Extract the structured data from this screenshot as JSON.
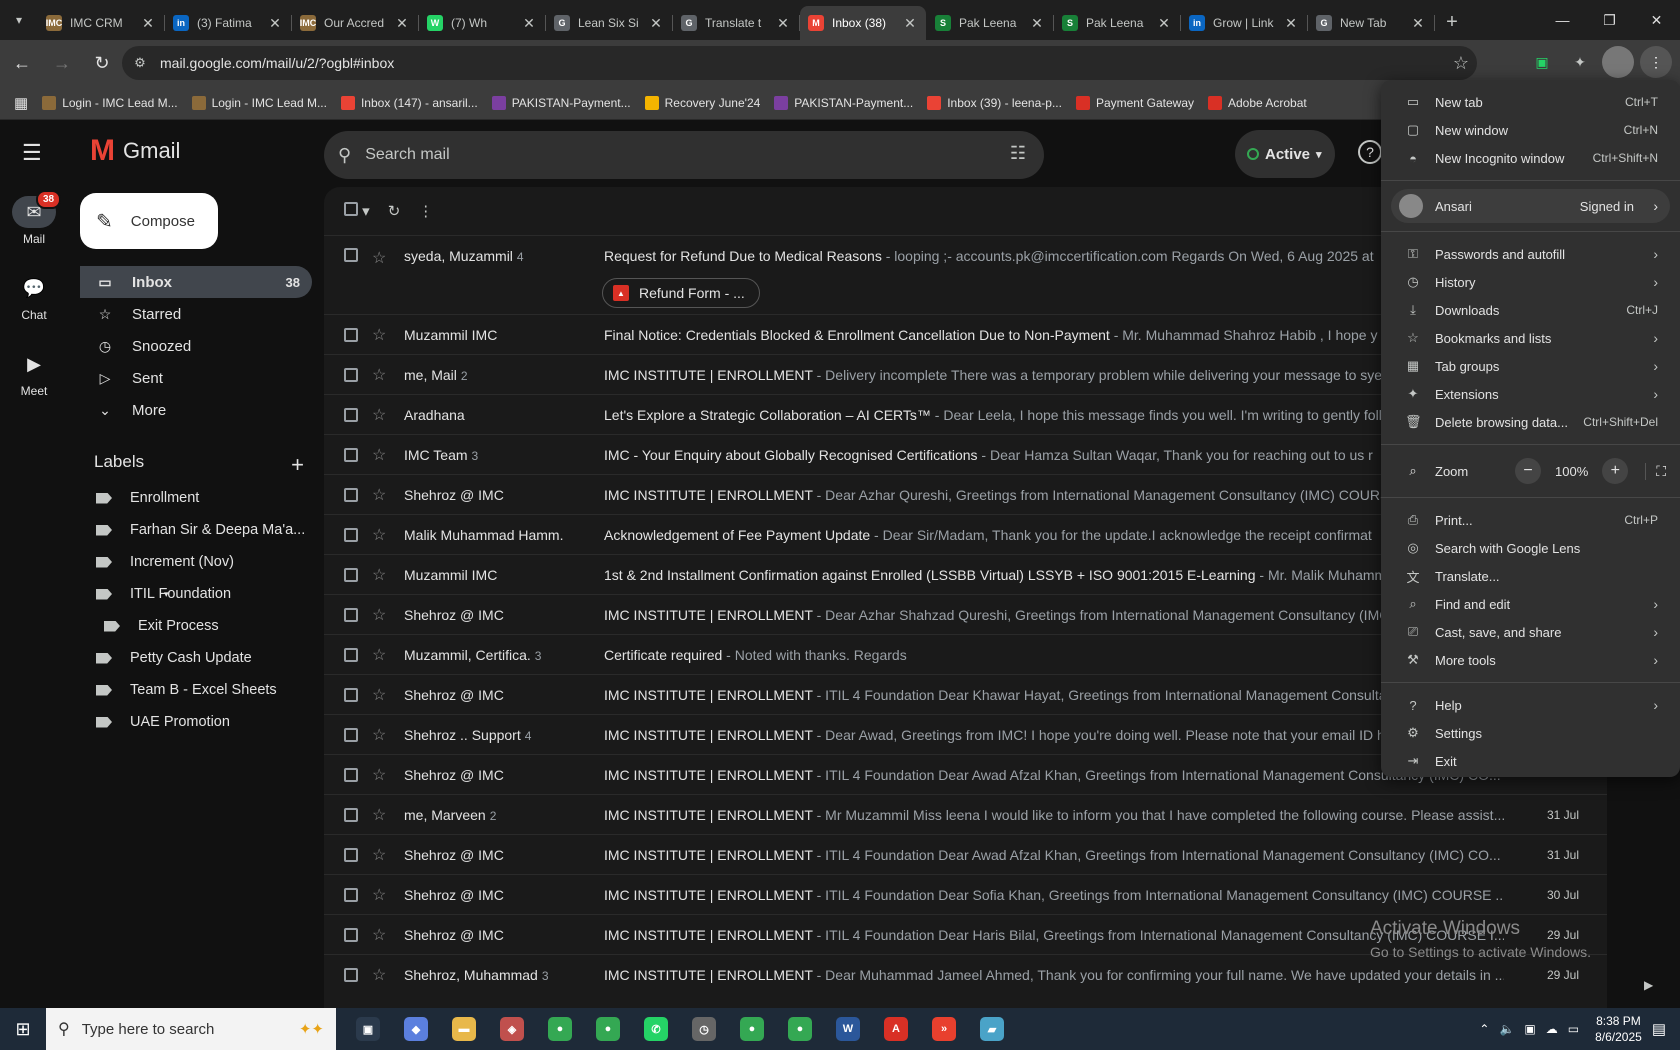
{
  "tabs": [
    {
      "title": "IMC CRM",
      "favicon": "IMC",
      "color": "#8b6a3a",
      "active": false
    },
    {
      "title": "(3) Fatima",
      "favicon": "in",
      "color": "#0a66c2",
      "active": false
    },
    {
      "title": "Our Accred",
      "favicon": "IMC",
      "color": "#8b6a3a",
      "active": false
    },
    {
      "title": "(7) Wh",
      "favicon": "W",
      "color": "#25d366",
      "active": false
    },
    {
      "title": "Lean Six Si",
      "favicon": "G",
      "color": "#5f6368",
      "active": false
    },
    {
      "title": "Translate t",
      "favicon": "G",
      "color": "#5f6368",
      "active": false
    },
    {
      "title": "Inbox (38)",
      "favicon": "M",
      "color": "#ea4335",
      "active": true
    },
    {
      "title": "Pak Leena",
      "favicon": "S",
      "color": "#188038",
      "active": false
    },
    {
      "title": "Pak Leena",
      "favicon": "S",
      "color": "#188038",
      "active": false
    },
    {
      "title": "Grow | Link",
      "favicon": "in",
      "color": "#0a66c2",
      "active": false
    },
    {
      "title": "New Tab",
      "favicon": "G",
      "color": "#5f6368",
      "active": false
    }
  ],
  "address": {
    "url": "mail.google.com/mail/u/2/?ogbl#inbox"
  },
  "bookmarks": [
    {
      "label": "Login - IMC Lead M...",
      "color": "#8b6a3a"
    },
    {
      "label": "Login - IMC Lead M...",
      "color": "#8b6a3a"
    },
    {
      "label": "Inbox (147) - ansaril...",
      "color": "#ea4335"
    },
    {
      "label": "PAKISTAN-Payment...",
      "color": "#7b3fa0"
    },
    {
      "label": "Recovery June'24",
      "color": "#f4b400"
    },
    {
      "label": "PAKISTAN-Payment...",
      "color": "#7b3fa0"
    },
    {
      "label": "Inbox (39) - leena-p...",
      "color": "#ea4335"
    },
    {
      "label": "Payment Gateway",
      "color": "#d93025"
    },
    {
      "label": "Adobe Acrobat",
      "color": "#d93025"
    }
  ],
  "gmail": {
    "brand": "Gmail",
    "compose": "Compose",
    "search_placeholder": "Search mail",
    "status": "Active",
    "rail": [
      {
        "label": "Mail",
        "badge": "38"
      },
      {
        "label": "Chat"
      },
      {
        "label": "Meet"
      }
    ],
    "folders": [
      {
        "label": "Inbox",
        "count": "38",
        "icon": "inbox-icon"
      },
      {
        "label": "Starred",
        "count": "",
        "icon": "star-icon"
      },
      {
        "label": "Snoozed",
        "count": "",
        "icon": "clock-icon"
      },
      {
        "label": "Sent",
        "count": "",
        "icon": "send-icon"
      },
      {
        "label": "More",
        "count": "",
        "icon": "chevron-down-icon"
      }
    ],
    "labels_title": "Labels",
    "labels": [
      {
        "label": "Enrollment",
        "sub": false
      },
      {
        "label": "Farhan Sir & Deepa Ma'a...",
        "sub": false
      },
      {
        "label": "Increment (Nov)",
        "sub": false
      },
      {
        "label": "ITIL Foundation",
        "sub": false
      },
      {
        "label": "Exit Process",
        "sub": true
      },
      {
        "label": "Petty Cash Update",
        "sub": false
      },
      {
        "label": "Team B - Excel Sheets",
        "sub": false
      },
      {
        "label": "UAE Promotion",
        "sub": false
      }
    ],
    "emails": [
      {
        "sender": "syeda, Muzammil",
        "n": "4",
        "subject": "Request for Refund Due to Medical Reasons",
        "snippet": " - looping ;- accounts.pk@imccertification.com Regards On Wed, 6 Aug 2025 at",
        "date": "",
        "attachment": "Refund Form - ..."
      },
      {
        "sender": "Muzammil IMC",
        "n": "",
        "subject": "Final Notice: Credentials Blocked & Enrollment Cancellation Due to Non-Payment",
        "snippet": " - Mr. Muhammad Shahroz Habib , I hope y",
        "date": ""
      },
      {
        "sender": "me, Mail",
        "n": "2",
        "subject": "IMC INSTITUTE | ENROLLMENT",
        "snippet": " - Delivery incomplete There was a temporary problem while delivering your message to syed",
        "date": ""
      },
      {
        "sender": "Aradhana",
        "n": "",
        "subject": "Let's Explore a Strategic Collaboration – AI CERTs™",
        "snippet": " - Dear Leela, I hope this message finds you well. I'm writing to gently foll",
        "date": ""
      },
      {
        "sender": "IMC Team",
        "n": "3",
        "subject": "IMC - Your Enquiry about Globally Recognised Certifications",
        "snippet": " - Dear Hamza Sultan Waqar, Thank you for reaching out to us r",
        "date": ""
      },
      {
        "sender": "Shehroz @ IMC",
        "n": "",
        "subject": "IMC INSTITUTE | ENROLLMENT",
        "snippet": " - Dear Azhar Qureshi, Greetings from International Management Consultancy (IMC) COURSE",
        "date": ""
      },
      {
        "sender": "Malik Muhammad Hamm.",
        "n": "",
        "subject": "Acknowledgement of Fee Payment Update",
        "snippet": " - Dear Sir/Madam, Thank you for the update.I acknowledge the receipt confirmat",
        "date": ""
      },
      {
        "sender": "Muzammil IMC",
        "n": "",
        "subject": "1st & 2nd Installment Confirmation against Enrolled (LSSBB Virtual) LSSYB + ISO 9001:2015 E-Learning",
        "snippet": " - Mr. Malik Muhamm",
        "date": ""
      },
      {
        "sender": "Shehroz @ IMC",
        "n": "",
        "subject": "IMC INSTITUTE | ENROLLMENT",
        "snippet": " - Dear Azhar Shahzad Qureshi, Greetings from International Management Consultancy (IMC",
        "date": ""
      },
      {
        "sender": "Muzammil, Certifica.",
        "n": "3",
        "subject": "Certificate required",
        "snippet": " - Noted with thanks. Regards",
        "date": ""
      },
      {
        "sender": "Shehroz @ IMC",
        "n": "",
        "subject": "IMC INSTITUTE | ENROLLMENT",
        "snippet": " - ITIL 4 Foundation Dear Khawar Hayat, Greetings from International Management Consultar",
        "date": ""
      },
      {
        "sender": "Shehroz .. Support",
        "n": "4",
        "subject": "IMC INSTITUTE | ENROLLMENT",
        "snippet": " - Dear Awad, Greetings from IMC! I hope you're doing well. Please note that your email ID ha",
        "date": ""
      },
      {
        "sender": "Shehroz @ IMC",
        "n": "",
        "subject": "IMC INSTITUTE | ENROLLMENT",
        "snippet": " - ITIL 4 Foundation Dear Awad Afzal Khan, Greetings from International Management Consultancy (IMC) CO...",
        "date": ""
      },
      {
        "sender": "me, Marveen",
        "n": "2",
        "subject": "IMC INSTITUTE | ENROLLMENT",
        "snippet": " - Mr Muzammil Miss leena I would like to inform you that I have completed the following course. Please assist...",
        "date": "31 Jul"
      },
      {
        "sender": "Shehroz @ IMC",
        "n": "",
        "subject": "IMC INSTITUTE | ENROLLMENT",
        "snippet": " - ITIL 4 Foundation Dear Awad Afzal Khan, Greetings from International Management Consultancy (IMC) CO...",
        "date": "31 Jul"
      },
      {
        "sender": "Shehroz @ IMC",
        "n": "",
        "subject": "IMC INSTITUTE | ENROLLMENT",
        "snippet": " - ITIL 4 Foundation Dear Sofia Khan, Greetings from International Management Consultancy (IMC) COURSE ...",
        "date": "30 Jul"
      },
      {
        "sender": "Shehroz @ IMC",
        "n": "",
        "subject": "IMC INSTITUTE | ENROLLMENT",
        "snippet": " - ITIL 4 Foundation Dear Haris Bilal, Greetings from International Management Consultancy (IMC) COURSE I...",
        "date": "29 Jul"
      },
      {
        "sender": "Shehroz, Muhammad",
        "n": "3",
        "subject": "IMC INSTITUTE | ENROLLMENT",
        "snippet": " - Dear Muhammad Jameel Ahmed, Thank you for confirming your full name. We have updated your details in ...",
        "date": "29 Jul"
      }
    ]
  },
  "menu": {
    "items_top": [
      {
        "label": "New tab",
        "shortcut": "Ctrl+T",
        "icon": "new-tab-icon"
      },
      {
        "label": "New window",
        "shortcut": "Ctrl+N",
        "icon": "new-window-icon"
      },
      {
        "label": "New Incognito window",
        "shortcut": "Ctrl+Shift+N",
        "icon": "incognito-icon"
      }
    ],
    "profile": {
      "name": "Ansari",
      "status": "Signed in"
    },
    "items_mid": [
      {
        "label": "Passwords and autofill",
        "shortcut": "",
        "sub": true,
        "icon": "key-icon"
      },
      {
        "label": "History",
        "shortcut": "",
        "sub": true,
        "icon": "history-icon"
      },
      {
        "label": "Downloads",
        "shortcut": "Ctrl+J",
        "sub": false,
        "icon": "download-icon"
      },
      {
        "label": "Bookmarks and lists",
        "shortcut": "",
        "sub": true,
        "icon": "bookmark-icon"
      },
      {
        "label": "Tab groups",
        "shortcut": "",
        "sub": true,
        "icon": "tab-groups-icon"
      },
      {
        "label": "Extensions",
        "shortcut": "",
        "sub": true,
        "icon": "extension-icon"
      },
      {
        "label": "Delete browsing data...",
        "shortcut": "Ctrl+Shift+Del",
        "sub": false,
        "icon": "trash-icon"
      }
    ],
    "zoom": {
      "label": "Zoom",
      "value": "100%"
    },
    "items_low": [
      {
        "label": "Print...",
        "shortcut": "Ctrl+P",
        "sub": false,
        "icon": "print-icon"
      },
      {
        "label": "Search with Google Lens",
        "shortcut": "",
        "sub": false,
        "icon": "lens-icon"
      },
      {
        "label": "Translate...",
        "shortcut": "",
        "sub": false,
        "icon": "translate-icon"
      },
      {
        "label": "Find and edit",
        "shortcut": "",
        "sub": true,
        "icon": "find-icon"
      },
      {
        "label": "Cast, save, and share",
        "shortcut": "",
        "sub": true,
        "icon": "cast-icon"
      },
      {
        "label": "More tools",
        "shortcut": "",
        "sub": true,
        "icon": "tools-icon"
      }
    ],
    "items_end": [
      {
        "label": "Help",
        "shortcut": "",
        "sub": true,
        "icon": "help-icon"
      },
      {
        "label": "Settings",
        "shortcut": "",
        "sub": false,
        "icon": "gear-icon"
      },
      {
        "label": "Exit",
        "shortcut": "",
        "sub": false,
        "icon": "exit-icon"
      }
    ]
  },
  "watermark": {
    "line1": "Activate Windows",
    "line2": "Go to Settings to activate Windows."
  },
  "taskbar": {
    "search_placeholder": "Type here to search",
    "time": "8:38 PM",
    "date": "8/6/2025",
    "apps": [
      {
        "icon": "task-view-icon",
        "glyph": "▣",
        "color": "#2b3a4c"
      },
      {
        "icon": "copilot-icon",
        "glyph": "◆",
        "color": "#5b7fde"
      },
      {
        "icon": "file-explorer-icon",
        "glyph": "▬",
        "color": "#e8b84a"
      },
      {
        "icon": "app-icon",
        "glyph": "◈",
        "color": "#c0504d"
      },
      {
        "icon": "chrome-icon",
        "glyph": "●",
        "color": "#34a853"
      },
      {
        "icon": "chrome-icon",
        "glyph": "●",
        "color": "#34a853"
      },
      {
        "icon": "whatsapp-icon",
        "glyph": "✆",
        "color": "#25d366"
      },
      {
        "icon": "clock-app-icon",
        "glyph": "◷",
        "color": "#666"
      },
      {
        "icon": "chrome-icon",
        "glyph": "●",
        "color": "#34a853"
      },
      {
        "icon": "chrome-icon",
        "glyph": "●",
        "color": "#34a853"
      },
      {
        "icon": "word-icon",
        "glyph": "W",
        "color": "#2b579a"
      },
      {
        "icon": "acrobat-icon",
        "glyph": "A",
        "color": "#d93025"
      },
      {
        "icon": "anydesk-icon",
        "glyph": "»",
        "color": "#e8402e"
      },
      {
        "icon": "app-icon",
        "glyph": "▰",
        "color": "#4aa3c8"
      }
    ]
  }
}
